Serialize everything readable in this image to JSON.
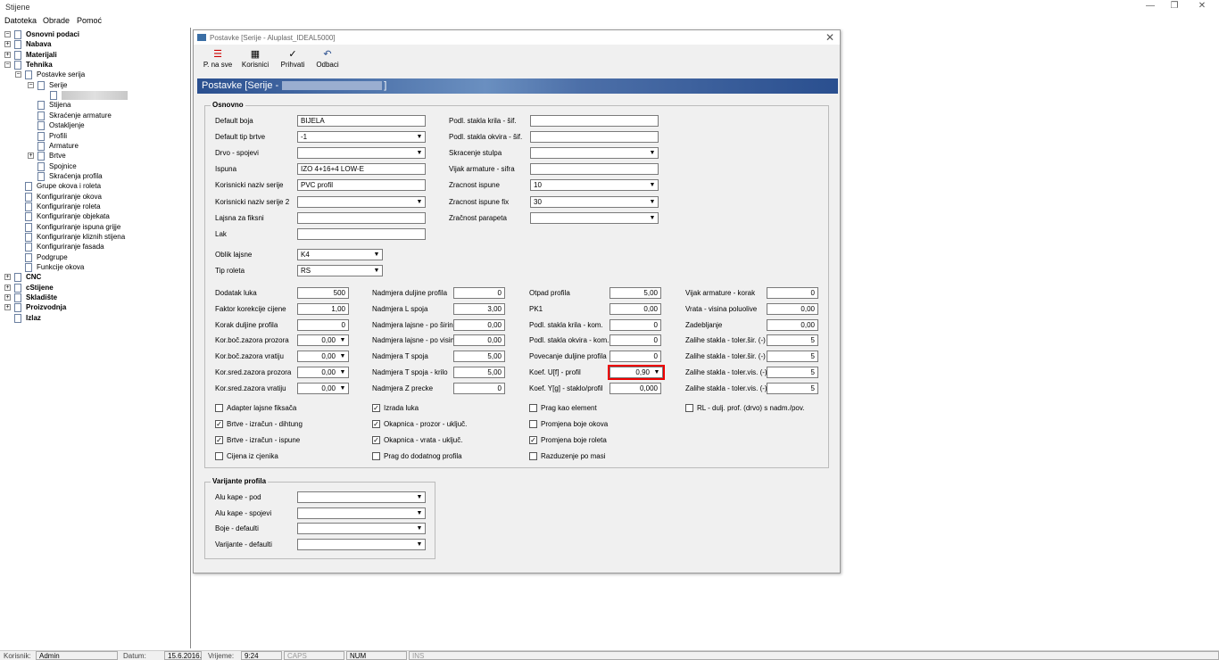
{
  "app": {
    "title": "Stijene",
    "menu": [
      "Datoteka",
      "Obrade",
      "Pomoć"
    ]
  },
  "tree": {
    "items": [
      {
        "label": "Osnovni podaci",
        "bold": true
      },
      {
        "label": "Nabava",
        "bold": true
      },
      {
        "label": "Materijali",
        "bold": true
      },
      {
        "label": "Tehnika",
        "bold": true
      },
      {
        "label": "Postavke serija"
      },
      {
        "label": "Serije"
      },
      {
        "label": ""
      },
      {
        "label": "Stijena"
      },
      {
        "label": "Skraćenje armature"
      },
      {
        "label": "Ostakljenje"
      },
      {
        "label": "Profili"
      },
      {
        "label": "Armature"
      },
      {
        "label": "Brtve"
      },
      {
        "label": "Spojnice"
      },
      {
        "label": "Skraćenja profila"
      },
      {
        "label": "Grupe okova i roleta"
      },
      {
        "label": "Konfiguriranje okova"
      },
      {
        "label": "Konfiguriranje roleta"
      },
      {
        "label": "Konfiguriranje objekata"
      },
      {
        "label": "Konfiguriranje ispuna grijje"
      },
      {
        "label": "Konfiguriranje kliznih stijena"
      },
      {
        "label": "Konfiguriranje fasada"
      },
      {
        "label": "Podgrupe"
      },
      {
        "label": "Funkcije okova"
      },
      {
        "label": "CNC",
        "bold": true
      },
      {
        "label": "cStijene",
        "bold": true
      },
      {
        "label": "Skladište",
        "bold": true
      },
      {
        "label": "Proizvodnja",
        "bold": true
      },
      {
        "label": "Izlaz",
        "bold": true
      }
    ]
  },
  "dialog": {
    "title": "Postavke  [Serije - Aluplast_IDEAL5000]",
    "banner": "Postavke  [Serije -",
    "toolbar": {
      "save_all": "P. na sve",
      "users": "Korisnici",
      "accept": "Prihvati",
      "cancel": "Odbaci"
    },
    "osnovno": {
      "title": "Osnovno",
      "default_boja": {
        "label": "Default boja",
        "value": "BIJELA"
      },
      "default_tip_brtve": {
        "label": "Default tip brtve",
        "value": "-1"
      },
      "drvo_spojevi": {
        "label": "Drvo - spojevi",
        "value": ""
      },
      "ispuna": {
        "label": "Ispuna",
        "value": "IZO 4+16+4 LOW-E"
      },
      "korisnicki_naziv": {
        "label": "Korisnicki naziv serije",
        "value": "PVC profil"
      },
      "korisnicki_naziv2": {
        "label": "Korisnicki naziv serije 2",
        "value": ""
      },
      "lajsna_za_fiksni": {
        "label": "Lajsna za fiksni",
        "value": ""
      },
      "lak": {
        "label": "Lak",
        "value": ""
      },
      "podl_stakla_krila": {
        "label": "Podl. stakla krila - šif.",
        "value": ""
      },
      "podl_stakla_okvira": {
        "label": "Podl. stakla okvira - šif.",
        "value": ""
      },
      "skracenje_stulpa": {
        "label": "Skracenje stulpa",
        "value": ""
      },
      "vijak_armature_sifra": {
        "label": "Vijak armature - sifra",
        "value": ""
      },
      "zracnost_ispune": {
        "label": "Zracnost ispune",
        "value": "10"
      },
      "zracnost_ispune_fix": {
        "label": "Zracnost ispune fix",
        "value": "30"
      },
      "zracnost_parapeta": {
        "label": "Zračnost parapeta",
        "value": ""
      },
      "oblik_lajsne": {
        "label": "Oblik lajsne",
        "value": "K4"
      },
      "tip_roleta": {
        "label": "Tip roleta",
        "value": "RS"
      },
      "col1": [
        {
          "label": "Dodatak luka",
          "value": "500",
          "combo": false
        },
        {
          "label": "Faktor korekcije cijene",
          "value": "1,00",
          "combo": false
        },
        {
          "label": "Korak duljine profila",
          "value": "0",
          "combo": false
        },
        {
          "label": "Kor.boč.zazora prozora",
          "value": "0,00",
          "combo": true
        },
        {
          "label": "Kor.boč.zazora vratiju",
          "value": "0,00",
          "combo": true
        },
        {
          "label": "Kor.sred.zazora prozora",
          "value": "0,00",
          "combo": true
        },
        {
          "label": "Kor.sred.zazora vratiju",
          "value": "0,00",
          "combo": true
        }
      ],
      "col2": [
        {
          "label": "Nadmjera duljine profila",
          "value": "0"
        },
        {
          "label": "Nadmjera L spoja",
          "value": "3,00"
        },
        {
          "label": "Nadmjera lajsne - po širini",
          "value": "0,00"
        },
        {
          "label": "Nadmjera lajsne - po visini",
          "value": "0,00"
        },
        {
          "label": "Nadmjera T spoja",
          "value": "5,00"
        },
        {
          "label": "Nadmjera T spoja - krilo",
          "value": "5,00"
        },
        {
          "label": "Nadmjera Z precke",
          "value": "0"
        }
      ],
      "col3": [
        {
          "label": "Otpad profila",
          "value": "5,00",
          "combo": false
        },
        {
          "label": "PK1",
          "value": "0,00",
          "combo": false
        },
        {
          "label": "Podl. stakla krila - kom.",
          "value": "0",
          "combo": false
        },
        {
          "label": "Podl. stakla okvira - kom.",
          "value": "0",
          "combo": false
        },
        {
          "label": "Povecanje duljine profila",
          "value": "0",
          "combo": false
        },
        {
          "label": "Koef. U[f] - profil",
          "value": "0,90",
          "combo": true
        },
        {
          "label": "Koef. Y[g] - staklo/profil",
          "value": "0,000",
          "combo": false
        }
      ],
      "col4": [
        {
          "label": "Vijak armature - korak",
          "value": "0"
        },
        {
          "label": "Vrata - visina poluolive",
          "value": "0,00"
        },
        {
          "label": "Zadebljanje",
          "value": "0,00"
        },
        {
          "label": "Zalihe stakla - toler.šir. (-)",
          "value": "5"
        },
        {
          "label": "Zalihe stakla - toler.šir. (-)",
          "value": "5"
        },
        {
          "label": "Zalihe stakla - toler.vis. (-)",
          "value": "5"
        },
        {
          "label": "Zalihe stakla - toler.vis. (-)",
          "value": "5"
        }
      ],
      "checks": [
        {
          "label": "Adapter lajsne fiksača",
          "checked": false
        },
        {
          "label": "Brtve - izračun - dihtung",
          "checked": true
        },
        {
          "label": "Brtve - izračun - ispune",
          "checked": true
        },
        {
          "label": "Cijena iz cjenika",
          "checked": false
        },
        {
          "label": "Izrada luka",
          "checked": true
        },
        {
          "label": "Okapnica - prozor - uključ.",
          "checked": true
        },
        {
          "label": "Okapnica - vrata - uključ.",
          "checked": true
        },
        {
          "label": "Prag do dodatnog profila",
          "checked": false
        },
        {
          "label": "Prag kao element",
          "checked": false
        },
        {
          "label": "Promjena boje okova",
          "checked": false
        },
        {
          "label": "Promjena boje roleta",
          "checked": true
        },
        {
          "label": "Razduzenje po masi",
          "checked": false
        },
        {
          "label": "RL - dulj. prof. (drvo) s nadm./pov.",
          "checked": false
        }
      ]
    },
    "varijante": {
      "title": "Varijante profila",
      "items": [
        {
          "label": "Alu kape - pod",
          "value": ""
        },
        {
          "label": "Alu kape - spojevi",
          "value": ""
        },
        {
          "label": "Boje - defaulti",
          "value": ""
        },
        {
          "label": "Varijante - defaulti",
          "value": ""
        }
      ]
    }
  },
  "status": {
    "korisnik_label": "Korisnik:",
    "korisnik": "Admin",
    "datum_label": "Datum:",
    "datum": "15.6.2016.",
    "vrijeme_label": "Vrijeme:",
    "vrijeme": "9:24",
    "caps": "CAPS",
    "num": "NUM",
    "ins": "INS"
  }
}
